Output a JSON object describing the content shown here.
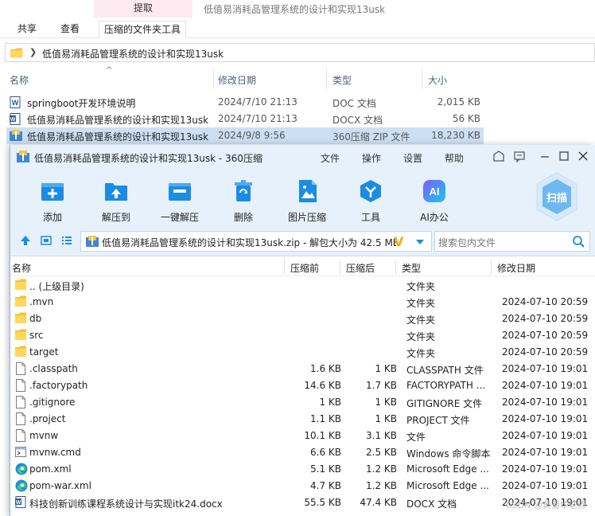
{
  "explorer": {
    "ribbon": {
      "context_group": "提取",
      "window_title": "低值易消耗品管理系统的设计和实现13usk",
      "tabs": [
        "共享",
        "查看",
        "压缩的文件夹工具"
      ]
    },
    "address": {
      "path": "低值易消耗品管理系统的设计和实现13usk"
    },
    "columns": {
      "name": "名称",
      "date": "修改日期",
      "type": "类型",
      "size": "大小"
    },
    "files": [
      {
        "name": "springboot开发环境说明",
        "date": "2024/7/10 21:13",
        "type": "DOC 文档",
        "size": "2,015 KB",
        "icon": "word-doc-icon"
      },
      {
        "name": "低值易消耗品管理系统的设计和实现13usk",
        "date": "2024/7/10 21:13",
        "type": "DOCX 文档",
        "size": "56 KB",
        "icon": "word-docx-icon"
      },
      {
        "name": "低值易消耗品管理系统的设计和实现13usk",
        "date": "2024/9/8 9:56",
        "type": "360压缩 ZIP 文件",
        "size": "18,230 KB",
        "icon": "zip-archive-icon",
        "selected": true
      }
    ]
  },
  "zip_window": {
    "title": "低值易消耗品管理系统的设计和实现13usk - 360压缩",
    "menu": [
      "文件",
      "操作",
      "设置",
      "帮助"
    ],
    "toolbar": [
      {
        "label": "添加",
        "icon": "add-icon"
      },
      {
        "label": "解压到",
        "icon": "extract-to-icon"
      },
      {
        "label": "一键解压",
        "icon": "one-click-extract-icon"
      },
      {
        "label": "删除",
        "icon": "delete-icon"
      },
      {
        "label": "图片压缩",
        "icon": "image-compress-icon"
      },
      {
        "label": "工具",
        "icon": "tools-icon"
      },
      {
        "label": "AI办公",
        "icon": "ai-office-icon"
      }
    ],
    "scan_label": "扫描",
    "path_text": "低值易消耗品管理系统的设计和实现13usk.zip - 解包大小为 42.5 MB",
    "search_placeholder": "搜索包内文件",
    "columns": {
      "name": "名称",
      "before": "压缩前",
      "after": "压缩后",
      "type": "类型",
      "date": "修改日期"
    },
    "rows": [
      {
        "name": ".. (上级目录)",
        "before": "",
        "after": "",
        "type": "文件夹",
        "date": "",
        "icon": "folder-icon"
      },
      {
        "name": ".mvn",
        "before": "",
        "after": "",
        "type": "文件夹",
        "date": "2024-07-10 20:59",
        "icon": "folder-icon"
      },
      {
        "name": "db",
        "before": "",
        "after": "",
        "type": "文件夹",
        "date": "2024-07-10 20:59",
        "icon": "folder-icon"
      },
      {
        "name": "src",
        "before": "",
        "after": "",
        "type": "文件夹",
        "date": "2024-07-10 20:59",
        "icon": "folder-icon"
      },
      {
        "name": "target",
        "before": "",
        "after": "",
        "type": "文件夹",
        "date": "2024-07-10 20:59",
        "icon": "folder-icon"
      },
      {
        "name": ".classpath",
        "before": "1.6 KB",
        "after": "1 KB",
        "type": "CLASSPATH 文件",
        "date": "2024-07-10 19:01",
        "icon": "file-icon"
      },
      {
        "name": ".factorypath",
        "before": "14.6 KB",
        "after": "1.7 KB",
        "type": "FACTORYPATH ...",
        "date": "2024-07-10 19:01",
        "icon": "file-icon"
      },
      {
        "name": ".gitignore",
        "before": "1 KB",
        "after": "1 KB",
        "type": "GITIGNORE 文件",
        "date": "2024-07-10 19:01",
        "icon": "file-icon"
      },
      {
        "name": ".project",
        "before": "1.1 KB",
        "after": "1 KB",
        "type": "PROJECT 文件",
        "date": "2024-07-10 19:01",
        "icon": "file-icon"
      },
      {
        "name": "mvnw",
        "before": "10.1 KB",
        "after": "3.1 KB",
        "type": "文件",
        "date": "2024-07-10 19:01",
        "icon": "file-icon"
      },
      {
        "name": "mvnw.cmd",
        "before": "6.6 KB",
        "after": "2.5 KB",
        "type": "Windows 命令脚本",
        "date": "2024-07-10 19:01",
        "icon": "cmd-script-icon"
      },
      {
        "name": "pom.xml",
        "before": "5.1 KB",
        "after": "1.2 KB",
        "type": "Microsoft Edge ...",
        "date": "2024-07-10 19:01",
        "icon": "edge-icon"
      },
      {
        "name": "pom-war.xml",
        "before": "4.7 KB",
        "after": "1.2 KB",
        "type": "Microsoft Edge ...",
        "date": "2024-07-10 19:01",
        "icon": "edge-icon"
      },
      {
        "name": "科技创新训练课程系统设计与实现itk24.docx",
        "before": "55.5 KB",
        "after": "47.4 KB",
        "type": "DOCX 文档",
        "date": "2024-07-10 19:01",
        "icon": "word-docx-icon"
      }
    ],
    "watermark": "CSDN @黄菊华老师"
  },
  "colors": {
    "accent": "#1a8ce6",
    "toolbar_bg": "#e6f1fb",
    "selection": "#cde0f3",
    "folder": "#f5c242",
    "ribbon_context": "#fde9f0"
  }
}
